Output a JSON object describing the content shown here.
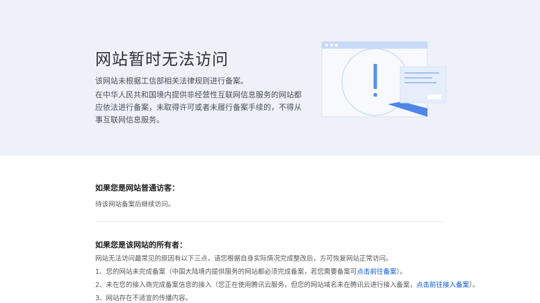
{
  "hero": {
    "title": "网站暂时无法访问",
    "subtitle": "该网站未根据工信部相关法律规则进行备案。",
    "description": "在中华人民共和国境内提供非经营性互联网信息服务的网站都应依法进行备案，未取得许可或者未履行备案手续的，不得从事互联网信息服务。",
    "illustration_icon": "browser-warning-icon"
  },
  "visitor": {
    "title": "如果您是网站普通访客：",
    "text": "待该网站备案后继续访问。"
  },
  "owner": {
    "title": "如果您是该网站的所有者：",
    "intro": "网站无法访问最常见的原因有以下三点，请您根据自身实际情况完成整改后，方可恢复网站正常访问。",
    "item1_prefix": "1、您的网站未完成备案（中国大陆境内提供服务的网站都必须完成备案，若您需要备案可",
    "item1_link": "点击前往备案",
    "item1_suffix": "）。",
    "item2_prefix": "2、未在您的接入商完成备案信息的接入（您正在使用腾讯云服务，但您的网站域名未在腾讯云进行接入备案，",
    "item2_link": "点击前往接入备案",
    "item2_suffix": "）。",
    "item3": "3、网站存在不适宜的传播内容。"
  },
  "colors": {
    "hero_bg": "#eef2f8",
    "link": "#0052d9",
    "accent": "#4f86e8"
  }
}
